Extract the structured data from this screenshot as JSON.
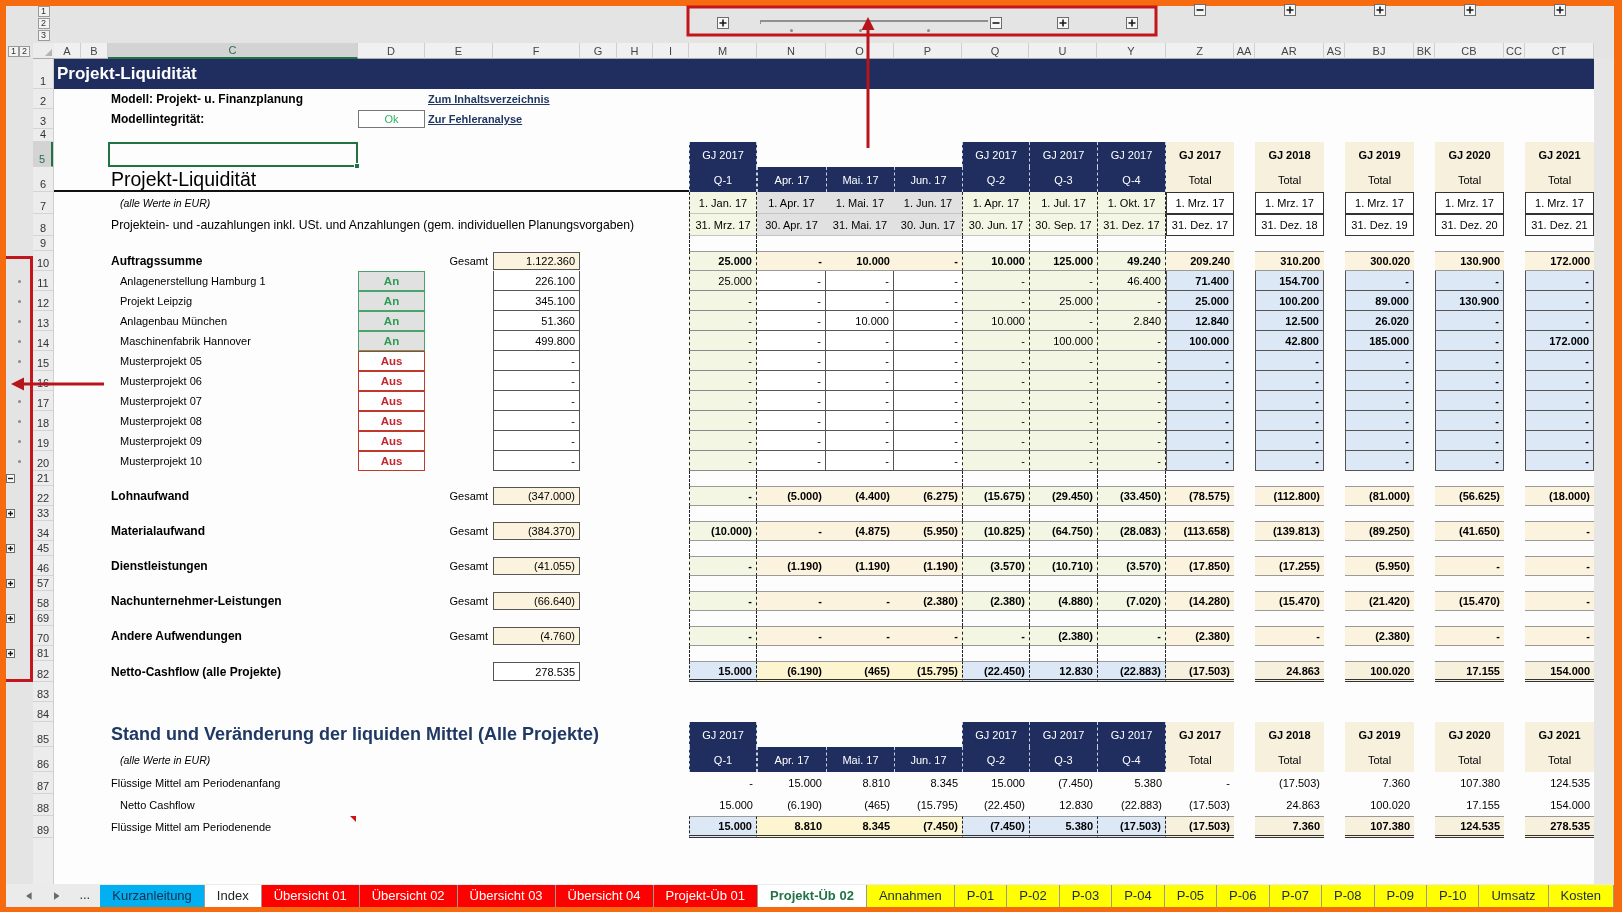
{
  "outline_levels": {
    "columns": [
      "1",
      "2",
      "3"
    ],
    "rows": [
      "1",
      "2"
    ]
  },
  "columns": [
    {
      "label": "A",
      "kind": "plain",
      "selected": false
    },
    {
      "label": "B",
      "kind": "plain",
      "selected": false
    },
    {
      "label": "C",
      "kind": "plain",
      "selected": true
    },
    {
      "label": "D",
      "kind": "plain",
      "selected": false
    },
    {
      "label": "E",
      "kind": "plain",
      "selected": false
    },
    {
      "label": "F",
      "kind": "plain",
      "selected": false
    },
    {
      "label": "G",
      "kind": "plain",
      "selected": false
    },
    {
      "label": "H",
      "kind": "plain",
      "selected": false
    },
    {
      "label": "I",
      "kind": "plain",
      "selected": false
    },
    {
      "label": "M",
      "kind": "quarter",
      "selected": false,
      "outline": {
        "kind": "inner",
        "expanded": false
      }
    },
    {
      "label": "N",
      "kind": "month",
      "selected": false,
      "outline": {
        "kind": "detail"
      }
    },
    {
      "label": "O",
      "kind": "month",
      "selected": false,
      "outline": {
        "kind": "detail"
      }
    },
    {
      "label": "P",
      "kind": "month",
      "selected": false,
      "outline": {
        "kind": "detail"
      }
    },
    {
      "label": "Q",
      "kind": "quarter",
      "selected": false,
      "outline": {
        "kind": "inner",
        "expanded": true
      }
    },
    {
      "label": "U",
      "kind": "quarter",
      "selected": false,
      "outline": {
        "kind": "inner",
        "expanded": false
      }
    },
    {
      "label": "Y",
      "kind": "quarter",
      "selected": false,
      "outline": {
        "kind": "inner",
        "expanded": false
      }
    },
    {
      "label": "Z",
      "kind": "year",
      "selected": false,
      "outline": {
        "kind": "outer",
        "expanded": true
      }
    },
    {
      "label": "AA",
      "kind": "plain",
      "selected": false
    },
    {
      "label": "AR",
      "kind": "year",
      "selected": false,
      "outline": {
        "kind": "outer",
        "expanded": false
      }
    },
    {
      "label": "AS",
      "kind": "plain",
      "selected": false
    },
    {
      "label": "BJ",
      "kind": "year",
      "selected": false,
      "outline": {
        "kind": "outer",
        "expanded": false
      }
    },
    {
      "label": "BK",
      "kind": "plain",
      "selected": false
    },
    {
      "label": "CB",
      "kind": "year",
      "selected": false,
      "outline": {
        "kind": "outer",
        "expanded": false
      }
    },
    {
      "label": "CC",
      "kind": "plain",
      "selected": false
    },
    {
      "label": "CT",
      "kind": "year",
      "selected": false,
      "outline": {
        "kind": "outer",
        "expanded": false
      }
    }
  ],
  "rows": [
    {
      "number": "1",
      "selected": false,
      "kind": "title",
      "label": {
        "kind": "title",
        "text": "Projekt-Liquidität"
      }
    },
    {
      "number": "2",
      "selected": false,
      "kind": "info",
      "label": {
        "kind": "bold",
        "text": "Modell: Projekt- u. Finanzplanung"
      },
      "link": "Zum Inhaltsverzeichnis"
    },
    {
      "number": "3",
      "selected": false,
      "kind": "info",
      "label": {
        "kind": "bold",
        "text": "Modellintegrität:"
      },
      "status": "Ok",
      "link": "Zur Fehleranalyse"
    },
    {
      "number": "4",
      "selected": false,
      "kind": "spacer"
    },
    {
      "number": "5",
      "selected": true,
      "kind": "headtop",
      "values": [
        "GJ 2017",
        "GJ 2017",
        "GJ 2017",
        "GJ 2017",
        "GJ 2017",
        "GJ 2018",
        "GJ 2019",
        "GJ 2020",
        "GJ 2021"
      ]
    },
    {
      "number": "6",
      "selected": false,
      "kind": "headbottom",
      "label": {
        "kind": "heading",
        "text": "Projekt-Liquidität"
      },
      "values": [
        "Q-1",
        "Apr. 17",
        "Mai. 17",
        "Jun. 17",
        "Q-2",
        "Q-3",
        "Q-4",
        "Total",
        "Total",
        "Total",
        "Total",
        "Total"
      ]
    },
    {
      "number": "7",
      "selected": false,
      "kind": "dates",
      "label": {
        "kind": "note",
        "text": "(alle Werte in EUR)"
      },
      "values": [
        "1. Jan. 17",
        "1. Apr. 17",
        "1. Mai. 17",
        "1. Jun. 17",
        "1. Apr. 17",
        "1. Jul. 17",
        "1. Okt. 17",
        "1. Mrz. 17",
        "1. Mrz. 17",
        "1. Mrz. 17",
        "1. Mrz. 17",
        "1. Mrz. 17"
      ]
    },
    {
      "number": "8",
      "selected": false,
      "kind": "dates",
      "label": {
        "kind": "caption",
        "text": "Projektein- und -auzahlungen inkl. USt. und Anzahlungen (gem. individuellen Planungsvorgaben)"
      },
      "values": [
        "31. Mrz. 17",
        "30. Apr. 17",
        "31. Mai. 17",
        "30. Jun. 17",
        "30. Jun. 17",
        "30. Sep. 17",
        "31. Dez. 17",
        "31. Dez. 17",
        "31. Dez. 18",
        "31. Dez. 19",
        "31. Dez. 20",
        "31. Dez. 21"
      ]
    },
    {
      "number": "9",
      "selected": false,
      "kind": "gap"
    },
    {
      "number": "10",
      "selected": false,
      "kind": "sum",
      "label": {
        "kind": "bold",
        "text": "Auftragssumme"
      },
      "total_label": "Gesamt",
      "total": "1.122.360",
      "values": [
        "25.000",
        "-",
        "10.000",
        "-",
        "10.000",
        "125.000",
        "49.240",
        "209.240",
        "310.200",
        "300.020",
        "130.900",
        "172.000"
      ]
    },
    {
      "number": "11",
      "selected": false,
      "kind": "item",
      "outline": {
        "kind": "dot"
      },
      "label": {
        "kind": "indented",
        "text": "Anlagenerstellung Hamburg 1"
      },
      "switch": {
        "label": "An",
        "on": true
      },
      "total": "226.100",
      "values": [
        "25.000",
        "-",
        "-",
        "-",
        "-",
        "-",
        "46.400",
        "71.400",
        "154.700",
        "-",
        "-",
        "-"
      ]
    },
    {
      "number": "12",
      "selected": false,
      "kind": "item",
      "outline": {
        "kind": "dot"
      },
      "label": {
        "kind": "indented",
        "text": "Projekt Leipzig"
      },
      "switch": {
        "label": "An",
        "on": true
      },
      "total": "345.100",
      "values": [
        "-",
        "-",
        "-",
        "-",
        "-",
        "25.000",
        "-",
        "25.000",
        "100.200",
        "89.000",
        "130.900",
        "-"
      ]
    },
    {
      "number": "13",
      "selected": false,
      "kind": "item",
      "outline": {
        "kind": "dot"
      },
      "label": {
        "kind": "indented",
        "text": "Anlagenbau München"
      },
      "switch": {
        "label": "An",
        "on": true
      },
      "total": "51.360",
      "values": [
        "-",
        "-",
        "10.000",
        "-",
        "10.000",
        "-",
        "2.840",
        "12.840",
        "12.500",
        "26.020",
        "-",
        "-"
      ]
    },
    {
      "number": "14",
      "selected": false,
      "kind": "item",
      "outline": {
        "kind": "dot"
      },
      "label": {
        "kind": "indented",
        "text": "Maschinenfabrik Hannover"
      },
      "switch": {
        "label": "An",
        "on": true
      },
      "total": "499.800",
      "values": [
        "-",
        "-",
        "-",
        "-",
        "-",
        "100.000",
        "-",
        "100.000",
        "42.800",
        "185.000",
        "-",
        "172.000"
      ]
    },
    {
      "number": "15",
      "selected": false,
      "kind": "item",
      "outline": {
        "kind": "dot"
      },
      "label": {
        "kind": "indented",
        "text": "Musterprojekt 05"
      },
      "switch": {
        "label": "Aus",
        "on": false
      },
      "total": "-",
      "values": [
        "-",
        "-",
        "-",
        "-",
        "-",
        "-",
        "-",
        "-",
        "-",
        "-",
        "-",
        "-"
      ]
    },
    {
      "number": "16",
      "selected": false,
      "kind": "item",
      "outline": {
        "kind": "dot"
      },
      "label": {
        "kind": "indented",
        "text": "Musterprojekt 06"
      },
      "switch": {
        "label": "Aus",
        "on": false
      },
      "total": "-",
      "values": [
        "-",
        "-",
        "-",
        "-",
        "-",
        "-",
        "-",
        "-",
        "-",
        "-",
        "-",
        "-"
      ]
    },
    {
      "number": "17",
      "selected": false,
      "kind": "item",
      "outline": {
        "kind": "dot"
      },
      "label": {
        "kind": "indented",
        "text": "Musterprojekt 07"
      },
      "switch": {
        "label": "Aus",
        "on": false
      },
      "total": "-",
      "values": [
        "-",
        "-",
        "-",
        "-",
        "-",
        "-",
        "-",
        "-",
        "-",
        "-",
        "-",
        "-"
      ]
    },
    {
      "number": "18",
      "selected": false,
      "kind": "item",
      "outline": {
        "kind": "dot"
      },
      "label": {
        "kind": "indented",
        "text": "Musterprojekt 08"
      },
      "switch": {
        "label": "Aus",
        "on": false
      },
      "total": "-",
      "values": [
        "-",
        "-",
        "-",
        "-",
        "-",
        "-",
        "-",
        "-",
        "-",
        "-",
        "-",
        "-"
      ]
    },
    {
      "number": "19",
      "selected": false,
      "kind": "item",
      "outline": {
        "kind": "dot"
      },
      "label": {
        "kind": "indented",
        "text": "Musterprojekt 09"
      },
      "switch": {
        "label": "Aus",
        "on": false
      },
      "total": "-",
      "values": [
        "-",
        "-",
        "-",
        "-",
        "-",
        "-",
        "-",
        "-",
        "-",
        "-",
        "-",
        "-"
      ]
    },
    {
      "number": "20",
      "selected": false,
      "kind": "item",
      "outline": {
        "kind": "dot"
      },
      "label": {
        "kind": "indented",
        "text": "Musterprojekt 10"
      },
      "switch": {
        "label": "Aus",
        "on": false
      },
      "total": "-",
      "values": [
        "-",
        "-",
        "-",
        "-",
        "-",
        "-",
        "-",
        "-",
        "-",
        "-",
        "-",
        "-"
      ]
    },
    {
      "number": "21",
      "selected": false,
      "kind": "gap",
      "outline": {
        "kind": "button",
        "expanded": true
      }
    },
    {
      "number": "22",
      "selected": false,
      "kind": "expense",
      "label": {
        "kind": "bold",
        "text": "Lohnaufwand"
      },
      "total_label": "Gesamt",
      "total": "(347.000)",
      "values": [
        "-",
        "(5.000)",
        "(4.400)",
        "(6.275)",
        "(15.675)",
        "(29.450)",
        "(33.450)",
        "(78.575)",
        "(112.800)",
        "(81.000)",
        "(56.625)",
        "(18.000)"
      ]
    },
    {
      "number": "33",
      "selected": false,
      "kind": "gap",
      "outline": {
        "kind": "button",
        "expanded": false
      }
    },
    {
      "number": "34",
      "selected": false,
      "kind": "expense",
      "label": {
        "kind": "bold",
        "text": "Materialaufwand"
      },
      "total_label": "Gesamt",
      "total": "(384.370)",
      "values": [
        "(10.000)",
        "-",
        "(4.875)",
        "(5.950)",
        "(10.825)",
        "(64.750)",
        "(28.083)",
        "(113.658)",
        "(139.813)",
        "(89.250)",
        "(41.650)",
        "-"
      ]
    },
    {
      "number": "45",
      "selected": false,
      "kind": "gap",
      "outline": {
        "kind": "button",
        "expanded": false
      }
    },
    {
      "number": "46",
      "selected": false,
      "kind": "expense",
      "label": {
        "kind": "bold",
        "text": "Dienstleistungen"
      },
      "total_label": "Gesamt",
      "total": "(41.055)",
      "values": [
        "-",
        "(1.190)",
        "(1.190)",
        "(1.190)",
        "(3.570)",
        "(10.710)",
        "(3.570)",
        "(17.850)",
        "(17.255)",
        "(5.950)",
        "-",
        "-"
      ]
    },
    {
      "number": "57",
      "selected": false,
      "kind": "gap",
      "outline": {
        "kind": "button",
        "expanded": false
      }
    },
    {
      "number": "58",
      "selected": false,
      "kind": "expense",
      "label": {
        "kind": "bold",
        "text": "Nachunternehmer-Leistungen"
      },
      "total_label": "Gesamt",
      "total": "(66.640)",
      "values": [
        "-",
        "-",
        "-",
        "(2.380)",
        "(2.380)",
        "(4.880)",
        "(7.020)",
        "(14.280)",
        "(15.470)",
        "(21.420)",
        "(15.470)",
        "-"
      ]
    },
    {
      "number": "69",
      "selected": false,
      "kind": "gap",
      "outline": {
        "kind": "button",
        "expanded": false
      }
    },
    {
      "number": "70",
      "selected": false,
      "kind": "expense",
      "label": {
        "kind": "bold",
        "text": "Andere Aufwendungen"
      },
      "total_label": "Gesamt",
      "total": "(4.760)",
      "values": [
        "-",
        "-",
        "-",
        "-",
        "-",
        "(2.380)",
        "-",
        "(2.380)",
        "-",
        "(2.380)",
        "-",
        "-"
      ]
    },
    {
      "number": "81",
      "selected": false,
      "kind": "gap",
      "outline": {
        "kind": "button",
        "expanded": false
      }
    },
    {
      "number": "82",
      "selected": false,
      "kind": "total",
      "label": {
        "kind": "bold",
        "text": "Netto-Cashflow (alle Projekte)"
      },
      "total": "278.535",
      "values": [
        "15.000",
        "(6.190)",
        "(465)",
        "(15.795)",
        "(22.450)",
        "12.830",
        "(22.883)",
        "(17.503)",
        "24.863",
        "100.020",
        "17.155",
        "154.000"
      ]
    },
    {
      "number": "83",
      "selected": false,
      "kind": "blank"
    },
    {
      "number": "84",
      "selected": false,
      "kind": "blank"
    },
    {
      "number": "85",
      "selected": false,
      "kind": "headtop",
      "label": {
        "kind": "section",
        "text": "Stand und Veränderung der liquiden Mittel (Alle Projekte)"
      },
      "values": [
        "GJ 2017",
        "GJ 2017",
        "GJ 2017",
        "GJ 2017",
        "GJ 2017",
        "GJ 2018",
        "GJ 2019",
        "GJ 2020",
        "GJ 2021"
      ]
    },
    {
      "number": "86",
      "selected": false,
      "kind": "headbottom",
      "label": {
        "kind": "note",
        "text": "(alle Werte in EUR)"
      },
      "values": [
        "Q-1",
        "Apr. 17",
        "Mai. 17",
        "Jun. 17",
        "Q-2",
        "Q-3",
        "Q-4",
        "Total",
        "Total",
        "Total",
        "Total",
        "Total"
      ]
    },
    {
      "number": "87",
      "selected": false,
      "kind": "flow",
      "label": {
        "kind": "plain",
        "text": "Flüssige Mittel am Periodenanfang"
      },
      "values": [
        "-",
        "15.000",
        "8.810",
        "8.345",
        "15.000",
        "(7.450)",
        "5.380",
        "-",
        "(17.503)",
        "7.360",
        "107.380",
        "124.535"
      ]
    },
    {
      "number": "88",
      "selected": false,
      "kind": "flow",
      "label": {
        "kind": "indented",
        "text": "Netto Cashflow"
      },
      "values": [
        "15.000",
        "(6.190)",
        "(465)",
        "(15.795)",
        "(22.450)",
        "12.830",
        "(22.883)",
        "(17.503)",
        "24.863",
        "100.020",
        "17.155",
        "154.000"
      ]
    },
    {
      "number": "89",
      "selected": false,
      "kind": "flowtotal",
      "comment": true,
      "label": {
        "kind": "plain",
        "text": "Flüssige Mittel am Periodenende"
      },
      "values": [
        "15.000",
        "8.810",
        "8.345",
        "(7.450)",
        "(7.450)",
        "5.380",
        "(17.503)",
        "(17.503)",
        "7.360",
        "107.380",
        "124.535",
        "278.535"
      ]
    }
  ],
  "sheet_tabs": {
    "overflow": "...",
    "tabs": [
      {
        "label": "Kurzanleitung",
        "selected": false,
        "color": "#00b0f0"
      },
      {
        "label": "Index",
        "selected": false
      },
      {
        "label": "Übersicht 01",
        "selected": false,
        "color": "#ff0000"
      },
      {
        "label": "Übersicht 02",
        "selected": false,
        "color": "#ff0000"
      },
      {
        "label": "Übersicht 03",
        "selected": false,
        "color": "#ff0000"
      },
      {
        "label": "Übersicht 04",
        "selected": false,
        "color": "#ff0000"
      },
      {
        "label": "Projekt-Üb 01",
        "selected": false,
        "color": "#ff0000"
      },
      {
        "label": "Projekt-Üb 02",
        "selected": true
      },
      {
        "label": "Annahmen",
        "selected": false,
        "color": "#ffff00"
      },
      {
        "label": "P-01",
        "selected": false,
        "color": "#ffff00"
      },
      {
        "label": "P-02",
        "selected": false,
        "color": "#ffff00"
      },
      {
        "label": "P-03",
        "selected": false,
        "color": "#ffff00"
      },
      {
        "label": "P-04",
        "selected": false,
        "color": "#ffff00"
      },
      {
        "label": "P-05",
        "selected": false,
        "color": "#ffff00"
      },
      {
        "label": "P-06",
        "selected": false,
        "color": "#ffff00"
      },
      {
        "label": "P-07",
        "selected": false,
        "color": "#ffff00"
      },
      {
        "label": "P-08",
        "selected": false,
        "color": "#ffff00"
      },
      {
        "label": "P-09",
        "selected": false,
        "color": "#ffff00"
      },
      {
        "label": "P-10",
        "selected": false,
        "color": "#ffff00"
      },
      {
        "label": "Umsatz",
        "selected": false,
        "color": "#ffff00"
      },
      {
        "label": "Kosten",
        "selected": false,
        "color": "#ffff00"
      }
    ]
  }
}
